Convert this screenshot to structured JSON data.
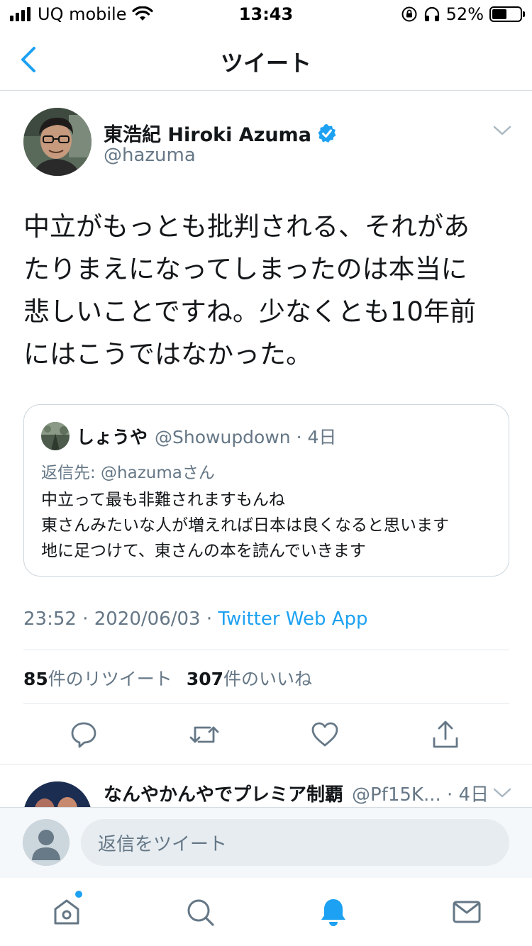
{
  "status_bar": {
    "carrier": "UQ mobile",
    "time": "13:43",
    "battery_percent": "52%",
    "battery_level": 0.52
  },
  "nav": {
    "title": "ツイート",
    "back_icon": "chevron-left-icon"
  },
  "tweet": {
    "author_name": "東浩紀 Hiroki Azuma",
    "author_handle": "@hazuma",
    "verified": true,
    "text": "中立がもっとも批判される、それがあ\nたりまえになってしまったのは本当に\n悲しいことですね。少なくとも10年前\nにはこうではなかった。",
    "timestamp": "23:52 · 2020/06/03 · ",
    "source": "Twitter Web App",
    "retweet_count": "85",
    "retweet_label": "件のリツイート",
    "like_count": "307",
    "like_label": "件のいいね"
  },
  "quoted_tweet": {
    "name": "しょうや",
    "handle_time": "@Showupdown · 4日",
    "reply_to": "返信先: @hazumaさん",
    "text": "中立って最も非難されますもんね\n東さんみたいな人が増えれば日本は良くなると思います\n地に足つけて、東さんの本を読んでいきます"
  },
  "actions": [
    "reply-icon",
    "retweet-icon",
    "like-icon",
    "share-icon"
  ],
  "reply_preview": {
    "name": "なんやかんやでプレミア制覇",
    "meta": "@Pf15K... · 4日"
  },
  "compose": {
    "placeholder": "返信をツイート"
  },
  "tabbar": {
    "items": [
      "home-icon",
      "search-icon",
      "notifications-icon",
      "messages-icon"
    ],
    "active": "notifications-icon"
  },
  "colors": {
    "accent": "#1da1f2",
    "text_primary": "#14171a",
    "text_secondary": "#657786",
    "border": "#e1e8ed"
  }
}
